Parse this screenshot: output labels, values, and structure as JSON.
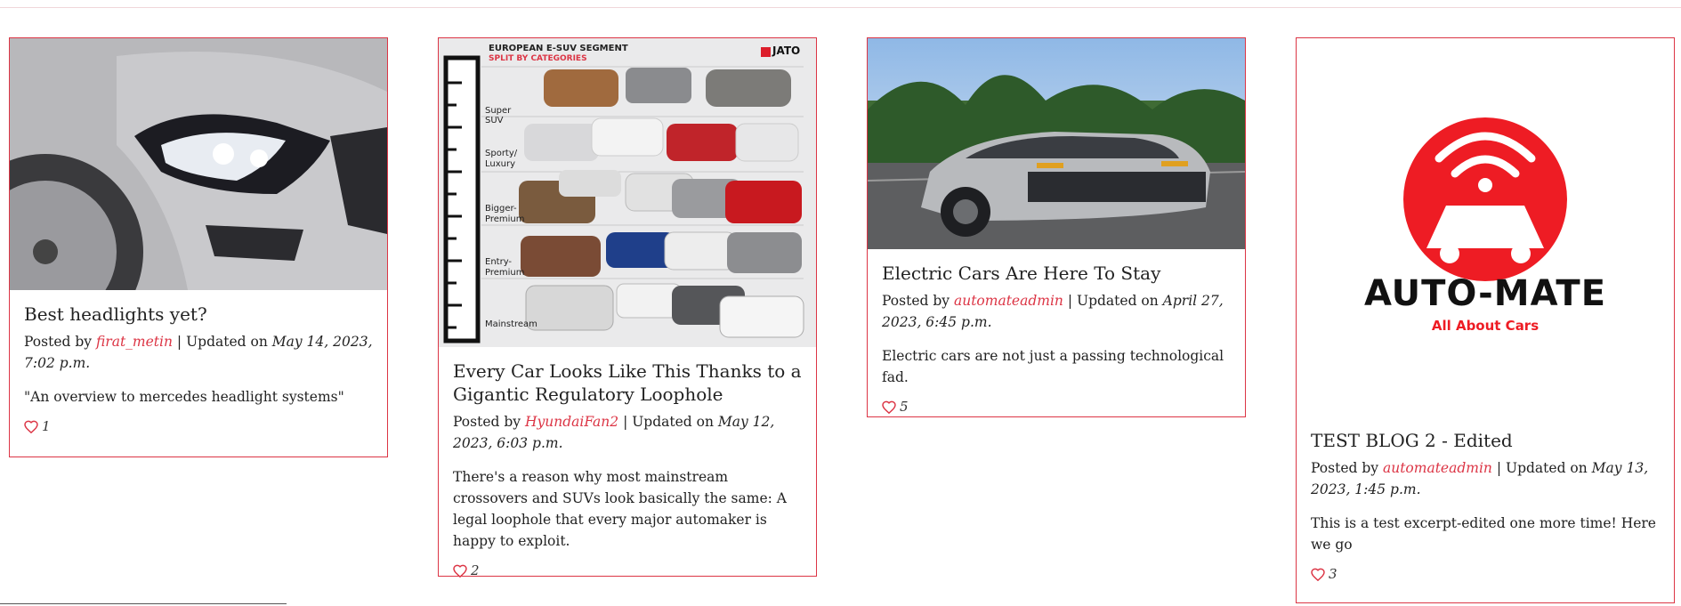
{
  "posts": [
    {
      "title": "Best headlights yet?",
      "posted_by_label": "Posted by",
      "author": "firat_metin",
      "separator": "|",
      "updated_label": "Updated on",
      "date": "May 14, 2023, 7:02 p.m.",
      "excerpt": "\"An overview to mercedes headlight systems\"",
      "likes": "1"
    },
    {
      "title": "Every Car Looks Like This Thanks to a Gigantic Regulatory Loophole",
      "posted_by_label": "Posted by",
      "author": "HyundaiFan2",
      "separator": "|",
      "updated_label": "Updated on",
      "date": "May 12, 2023, 6:03 p.m.",
      "excerpt": "There's a reason why most mainstream crossovers and SUVs look basically the same: A legal loophole that every major automaker is happy to exploit.",
      "likes": "2"
    },
    {
      "title": "Electric Cars Are Here To Stay",
      "posted_by_label": "Posted by",
      "author": "automateadmin",
      "separator": "|",
      "updated_label": "Updated on",
      "date": "April 27, 2023, 6:45 p.m.",
      "excerpt": "Electric cars are not just a passing technological fad.",
      "likes": "5"
    },
    {
      "title": "TEST BLOG 2 - Edited",
      "posted_by_label": "Posted by",
      "author": "automateadmin",
      "separator": "|",
      "updated_label": "Updated on",
      "date": "May 13, 2023, 1:45 p.m.",
      "excerpt": "This is a test excerpt-edited one more time! Here we go",
      "likes": "3"
    }
  ],
  "infographic": {
    "title": "EUROPEAN E-SUV SEGMENT",
    "subtitle": "SPLIT BY CATEGORIES",
    "brand": "JATO",
    "categories": [
      "Super SUV",
      "Sporty/ Luxury",
      "Bigger- Premium",
      "Entry- Premium",
      "Mainstream"
    ]
  },
  "logo": {
    "name": "AUTO-MATE",
    "tagline": "All About Cars"
  },
  "colors": {
    "accent": "#dc3545",
    "logo_red": "#ee1c24"
  }
}
